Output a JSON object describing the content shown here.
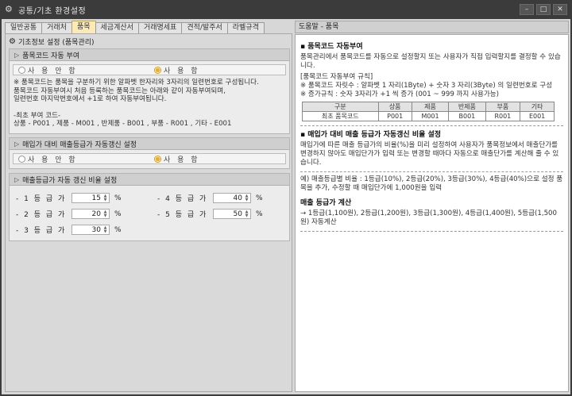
{
  "window": {
    "title": "공통/기초 환경설정"
  },
  "tabs": [
    "일반공통",
    "거래처",
    "품목",
    "세금계산서",
    "거래명세표",
    "견적/발주서",
    "라벨규격"
  ],
  "panel_title": "기초정보 설정 (품목관리)",
  "section1": {
    "title": "품목코드 자동 부여",
    "opt_off": "사 용 안 함",
    "opt_on": "사 용 함",
    "selected": "on",
    "notes": [
      "※ 품목코드는 품목을 구분하기 위한 알파벳 한자리와 3자리의 일련번호로 구성됩니다.",
      "품목코드 자동부여시 처음 등록하는 품목코드는 아래와 같이 자동부여되며,",
      "일련번호 마지막번호에서 +1로 하여 자동부여됩니다.",
      "",
      "-최초 부여 코드-",
      "상품 - P001 , 제품 - M001 , 반제품 - B001 , 부품 - R001 , 기타 - E001"
    ]
  },
  "section2": {
    "title": "매입가 대비 매출등급가 자동갱신 설정",
    "opt_off": "사 용 안 함",
    "opt_on": "사 용 함",
    "selected": "on"
  },
  "section3": {
    "title": "매출등급가 자동 갱신 비율 설정",
    "pct": "%",
    "rates": [
      {
        "label": "- 1 등 급 가",
        "value": "15"
      },
      {
        "label": "- 2 등 급 가",
        "value": "20"
      },
      {
        "label": "- 3 등 급 가",
        "value": "30"
      },
      {
        "label": "- 4 등 급 가",
        "value": "40"
      },
      {
        "label": "- 5 등 급 가",
        "value": "50"
      }
    ]
  },
  "help": {
    "title": "도움말 - 품목",
    "h1": "품목코드 자동부여",
    "p1": "품목관리에서 품목코드를 자동으로 설정할지 또는 사용자가 직접 입력할지를 결정할 수 있습니다.",
    "rule_title": "[품목코드 자동부여 규칙]",
    "rule1": "※ 품목코드 자릿수 : 알파벳 1 자리(1Byte) + 숫자 3 자리(3Byte) 의 일련번호로 구성",
    "rule2": "※ 증가규칙 : 숫자 3자리가 +1 씩 증가 (001 ~ 999 까지 사용가능)",
    "table_head": [
      "구분",
      "상품",
      "제품",
      "반제품",
      "부품",
      "기타"
    ],
    "table_row": [
      "최초 품목코드",
      "P001",
      "M001",
      "B001",
      "R001",
      "E001"
    ],
    "h2": "매입가 대비 매출 등급가 자동갱신 비율 설정",
    "p2": "매입가에 따른 매출 등급가의 비율(%)을 미리 설정하여 사용자가 품목정보에서 매출단가를 변경하지 않아도 매입단가가 입력 또는 변경할 때마다 자동으로 매출단가를 계산해 줄 수 있습니다.",
    "example": "예) 매출등급별 비율 : 1등급(10%), 2등급(20%), 3등급(30%), 4등급(40%)으로 설정 품목을 추가, 수정할 때 매입단가에 1,000원을 입력",
    "h3": "매출 등급가 계산",
    "calc": "→ 1등급(1,100원), 2등급(1,200원), 3등급(1,300원), 4등급(1,400원), 5등급(1,500원) 자동계산"
  }
}
